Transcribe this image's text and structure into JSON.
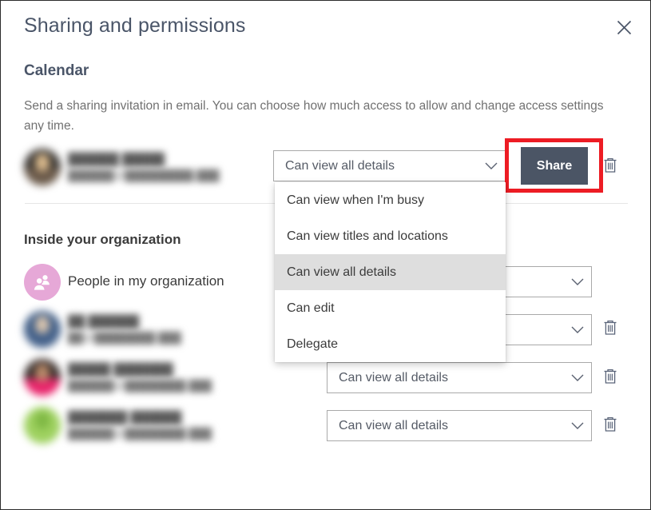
{
  "dialog": {
    "title": "Sharing and permissions",
    "close_icon": "close-icon"
  },
  "section": {
    "title": "Calendar",
    "description": "Send a sharing invitation in email. You can choose how much access to allow and change access settings any time."
  },
  "invite_row": {
    "person": {
      "name": "██████ █████",
      "email": "██████@█████████.███"
    },
    "permission": "Can view all details",
    "share_label": "Share",
    "delete_icon": "trash-icon"
  },
  "dropdown": {
    "open": true,
    "selected": "Can view all details",
    "options": [
      "Can view when I'm busy",
      "Can view titles and locations",
      "Can view all details",
      "Can edit",
      "Delegate"
    ]
  },
  "group": {
    "title": "Inside your organization",
    "org_entry": {
      "label": "People in my organization",
      "icon": "people-group-icon",
      "permission": "Can view all details"
    },
    "members": [
      {
        "name": "██ ██████",
        "email": "██@████████.███",
        "permission": "Can view all details",
        "delete_icon": "trash-icon"
      },
      {
        "name": "█████ ███████",
        "email": "██████@████████.███",
        "permission": "Can view all details",
        "delete_icon": "trash-icon"
      },
      {
        "name": "███████ ██████",
        "email": "██████@████████.███",
        "permission": "Can view all details",
        "delete_icon": "trash-icon"
      }
    ]
  },
  "colors": {
    "accent_button": "#4b5565",
    "highlight": "#ed1c24",
    "title_text": "#4a5568",
    "org_icon_bg": "#e6a8d7",
    "menu_selected_bg": "#dedede",
    "avatar_1": "#6b5a4a",
    "avatar_2": "#3f5d86",
    "avatar_3": "#e8256b",
    "avatar_4": "#9ed15f"
  }
}
